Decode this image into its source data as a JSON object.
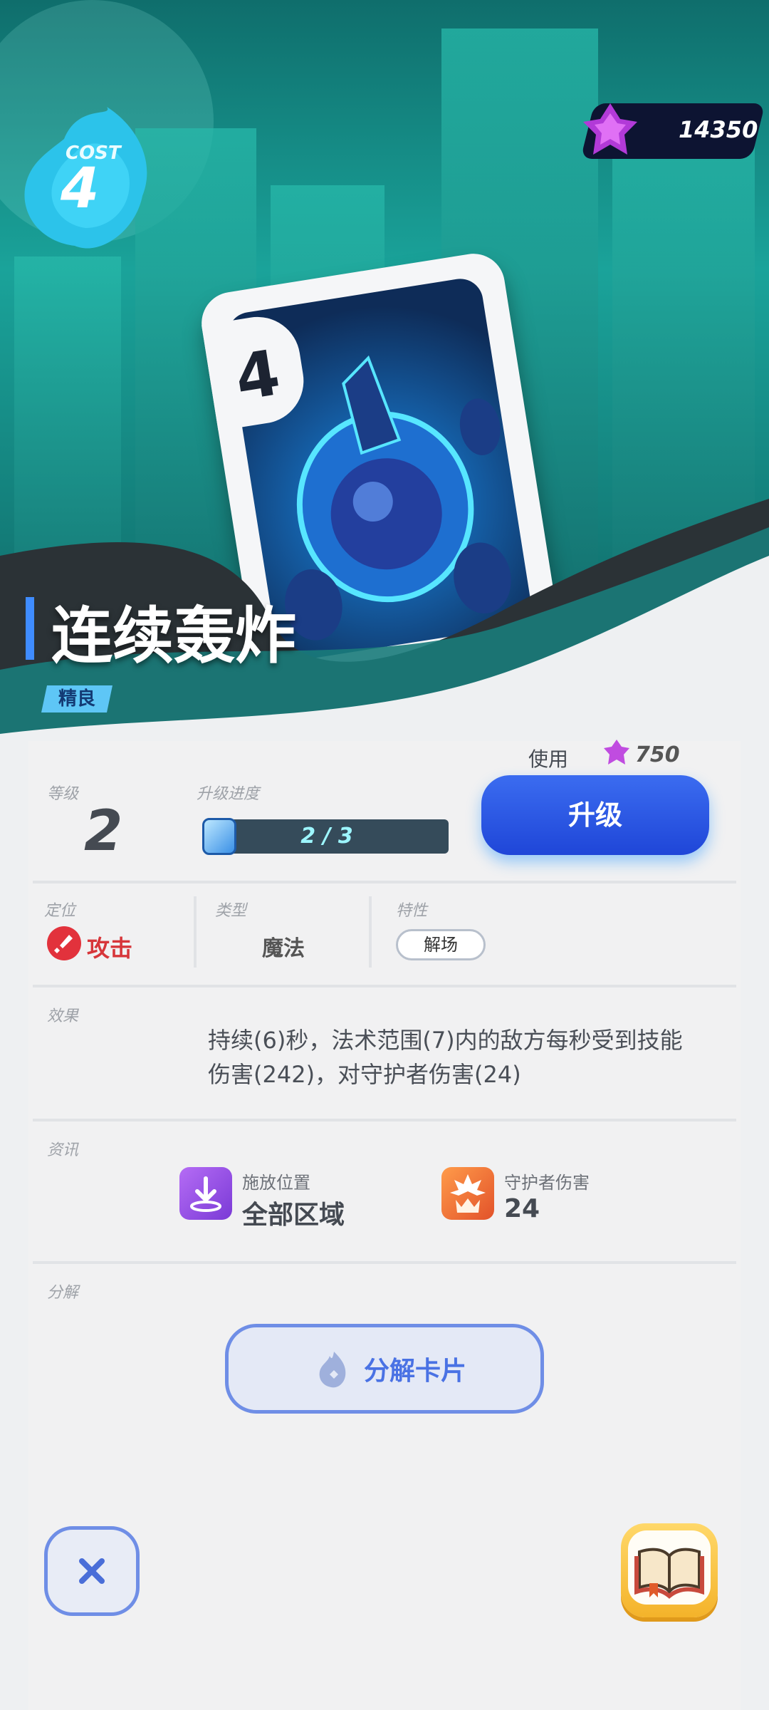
{
  "header": {
    "cost_label": "COST",
    "cost_value": "4",
    "currency_amount": "14350",
    "currency_icon": "purple-crystal-icon"
  },
  "card": {
    "cost": "4",
    "name": "连续轰炸",
    "rarity": "精良"
  },
  "upgrade": {
    "level_label": "等级",
    "level_value": "2",
    "progress_label": "升级进度",
    "progress_text": "2 / 3",
    "progress_fraction": 0.667,
    "use_label": "使用",
    "use_cost": "750",
    "button_label": "升级"
  },
  "attributes": {
    "role_label": "定位",
    "role_value": "攻击",
    "type_label": "类型",
    "type_value": "魔法",
    "trait_label": "特性",
    "trait_value": "解场"
  },
  "effect": {
    "label": "效果",
    "text_line1": "持续(6)秒，法术范围(7)内的敌方每秒受到技能",
    "text_line2": "伤害(242)，对守护者伤害(24)"
  },
  "info": {
    "label": "资讯",
    "cast_label": "施放位置",
    "cast_value": "全部区域",
    "guardian_label": "守护者伤害",
    "guardian_value": "24"
  },
  "disassemble": {
    "label": "分解",
    "button_label": "分解卡片"
  },
  "colors": {
    "accent": "#2f5ee8",
    "attack": "#d7363a",
    "rarity": "#5ec6f6"
  }
}
